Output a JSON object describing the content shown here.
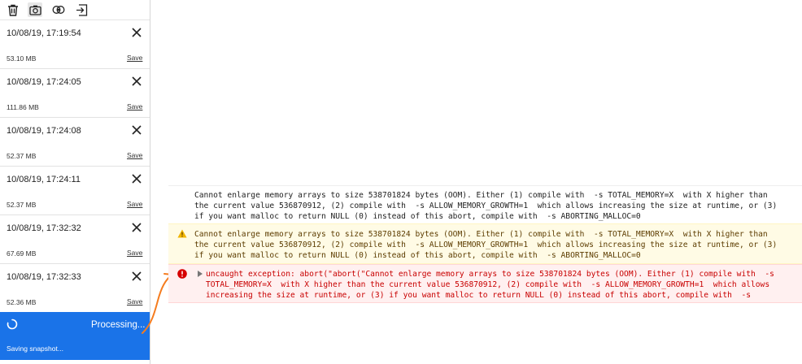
{
  "toolbar": {
    "icons": [
      "trash-icon",
      "camera-icon",
      "compare-icon",
      "export-icon"
    ]
  },
  "snapshots": [
    {
      "time": "10/08/19, 17:19:54",
      "size": "53.10 MB",
      "save": "Save"
    },
    {
      "time": "10/08/19, 17:24:05",
      "size": "111.86 MB",
      "save": "Save"
    },
    {
      "time": "10/08/19, 17:24:08",
      "size": "52.37 MB",
      "save": "Save"
    },
    {
      "time": "10/08/19, 17:24:11",
      "size": "52.37 MB",
      "save": "Save"
    },
    {
      "time": "10/08/19, 17:32:32",
      "size": "67.69 MB",
      "save": "Save"
    },
    {
      "time": "10/08/19, 17:32:33",
      "size": "52.36 MB",
      "save": "Save"
    }
  ],
  "processing": {
    "label": "Processing...",
    "sub": "Saving snapshot..."
  },
  "console": {
    "log": [
      "Cannot enlarge memory arrays to size 538701824 bytes (OOM). Either (1) compile with  -s TOTAL_MEMORY=X  with X higher than",
      "the current value 536870912, (2) compile with  -s ALLOW_MEMORY_GROWTH=1  which allows increasing the size at runtime, or (3)",
      "if you want malloc to return NULL (0) instead of this abort, compile with  -s ABORTING_MALLOC=0"
    ],
    "warning": [
      "Cannot enlarge memory arrays to size 538701824 bytes (OOM). Either (1) compile with  -s TOTAL_MEMORY=X  with X higher than",
      "the current value 536870912, (2) compile with  -s ALLOW_MEMORY_GROWTH=1  which allows increasing the size at runtime, or (3)",
      "if you want malloc to return NULL (0) instead of this abort, compile with  -s ABORTING_MALLOC=0"
    ],
    "error": [
      "uncaught exception: abort(\"abort(\"Cannot enlarge memory arrays to size 538701824 bytes (OOM). Either (1) compile with  -s",
      "TOTAL_MEMORY=X  with X higher than the current value 536870912, (2) compile with  -s ALLOW_MEMORY_GROWTH=1  which allows",
      "increasing the size at runtime, or (3) if you want malloc to return NULL (0) instead of this abort, compile with  -s"
    ]
  },
  "colors": {
    "accent": "#1a73e8",
    "annotation_arrow": "#f57c1f",
    "warning_bg": "#fffbe5",
    "error_bg": "#fff0f0",
    "error_text": "#c80000"
  }
}
